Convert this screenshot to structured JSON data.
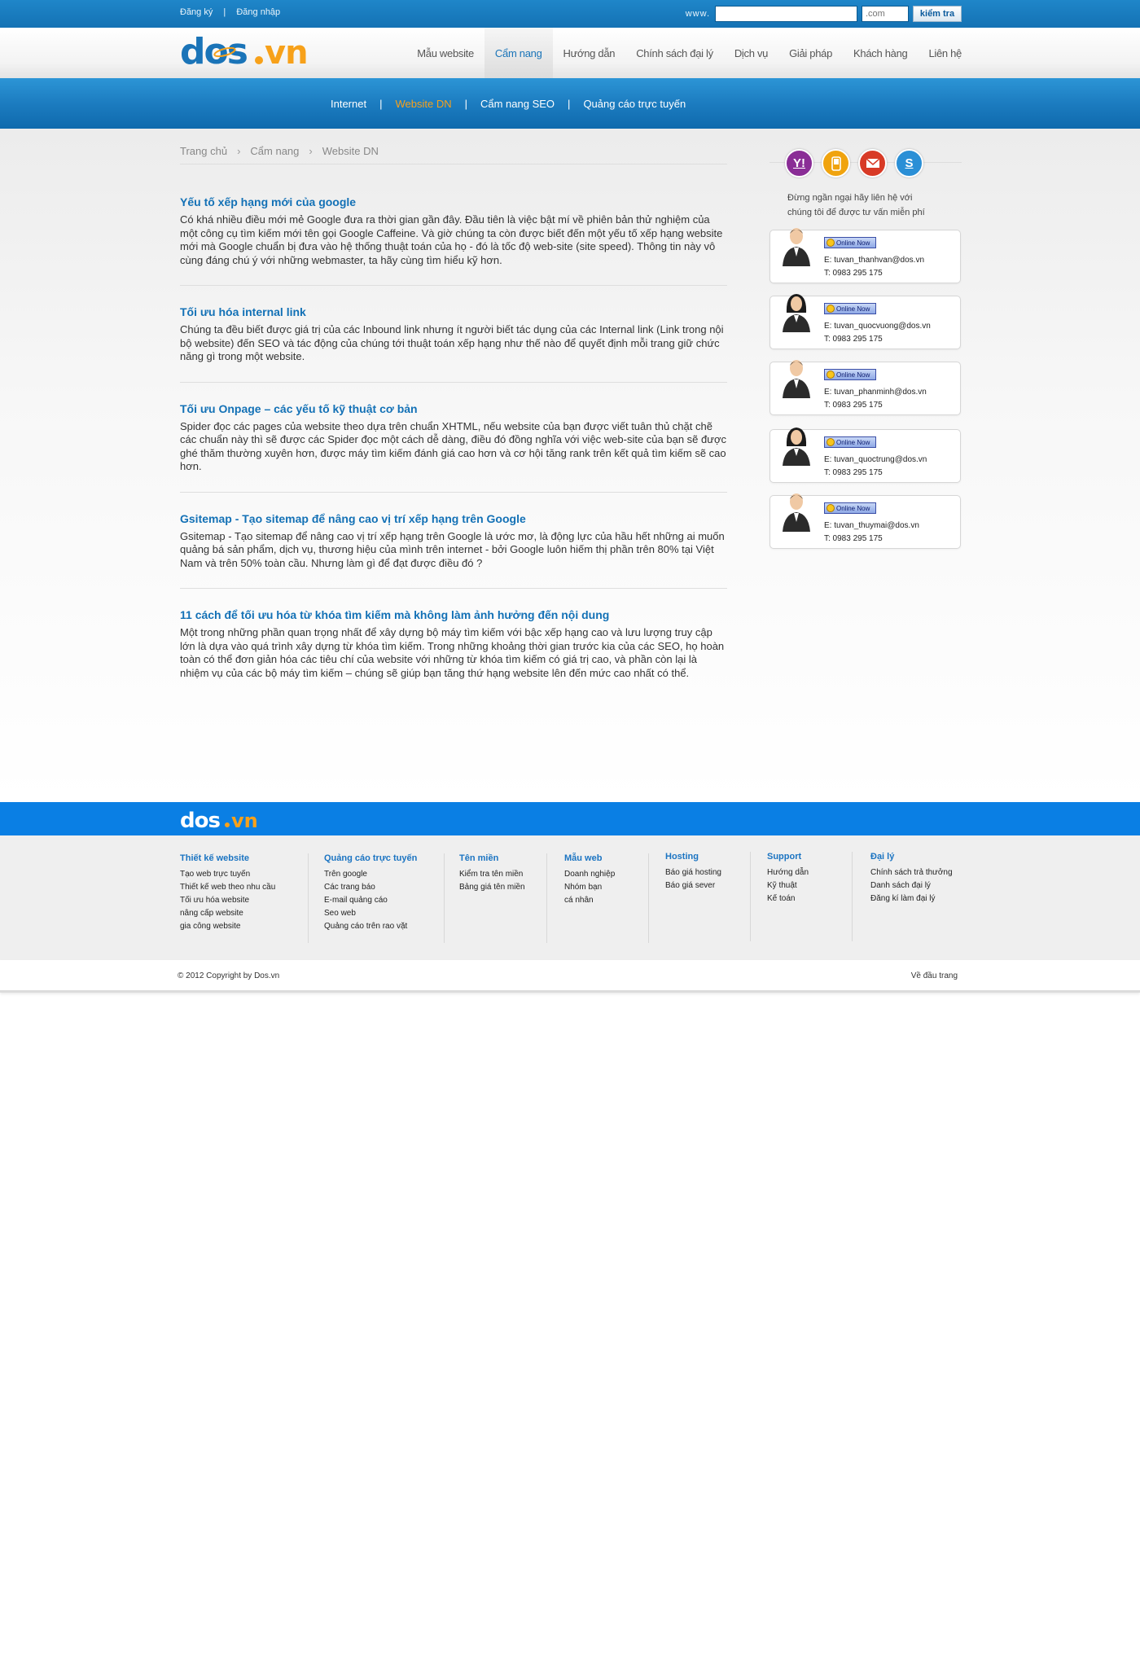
{
  "topbar": {
    "register": "Đăng ký",
    "separator": "|",
    "login": "Đăng nhập",
    "www_label": "www.",
    "domain_value": "",
    "ext_placeholder": ".com",
    "check_button": "kiểm tra"
  },
  "header": {
    "logo_text": "dos.vn",
    "nav": [
      "Mẫu website",
      "Cẩm nang",
      "Hướng dẫn",
      "Chính sách đại lý",
      "Dịch vụ",
      "Giải pháp",
      "Khách hàng",
      "Liên hệ"
    ],
    "nav_active": "Cẩm nang"
  },
  "subnav": {
    "items": [
      "Internet",
      "Website DN",
      "Cẩm nang SEO",
      "Quảng cáo trực tuyến"
    ],
    "separator": "|",
    "active": "Website DN"
  },
  "breadcrumb": [
    "Trang chủ",
    "Cẩm nang",
    "Website DN"
  ],
  "articles": [
    {
      "title": "Yếu tố xếp hạng mới của google",
      "text": "Có khá nhiều điều mới mẻ Google đưa ra thời gian gần đây. Đầu tiên là việc bật mí về phiên bản thử nghiệm của một công cụ tìm kiếm mới tên gọi Google Caffeine. Và giờ chúng ta còn được biết đến một yếu tố xếp hạng website mới mà Google chuẩn bị đưa vào hệ thống thuật toán của họ - đó là tốc độ web-site (site speed). Thông tin này vô cùng đáng chú ý với những webmaster, ta hãy cùng tìm hiểu kỹ hơn."
    },
    {
      "title": "Tối ưu hóa internal link",
      "text": "Chúng ta đều biết được giá trị của các Inbound link nhưng ít người biết tác dụng của các Internal link (Link trong nội bộ website) đến SEO và tác động của chúng tới thuật toán xếp hạng như thế nào để quyết định mỗi trang giữ chức năng gì trong một website."
    },
    {
      "title": "Tối ưu Onpage – các yếu tố kỹ thuật cơ bản",
      "text": "Spider đọc các pages của website theo dựa trên chuẩn XHTML, nếu website của bạn được viết tuân thủ chặt chẽ các chuẩn này thì sẽ được các Spider đọc một cách dễ dàng, điều đó đồng nghĩa với việc web-site của bạn sẽ được ghé thăm thường xuyên hơn, được máy tìm kiếm đánh giá cao hơn và cơ hội tăng rank trên kết quả tìm kiếm sẽ cao hơn."
    },
    {
      "title": "Gsitemap - Tạo sitemap để nâng cao vị trí xếp hạng trên Google",
      "text": "Gsitemap - Tạo sitemap để nâng cao vị trí xếp hạng trên Google là ước mơ, là động lực của hầu hết những ai muốn quảng bá sản phẩm, dịch vụ, thương hiệu của mình trên internet - bởi Google luôn hiếm thị phần trên 80% tại Việt Nam và trên 50% toàn cầu. Nhưng làm gì để đạt được điều đó ?"
    },
    {
      "title": "11 cách để tối ưu hóa từ khóa tìm kiếm mà không làm ảnh hưởng đến nội dung",
      "text": "Một trong những phần quan trọng nhất để xây dựng bộ máy tìm kiếm với bậc xếp hạng cao và lưu lượng truy cập lớn là dựa vào quá trình xây dựng từ khóa tìm kiếm. Trong những khoảng thời gian trước kia của các SEO, họ hoàn toàn có thể đơn giản hóa các tiêu chí của website với những từ khóa tìm kiếm có giá trị cao, và phần còn lại là nhiệm vụ của các bộ máy tìm kiếm – chúng sẽ giúp bạn tăng thứ hạng website lên đến mức cao nhất có thể."
    }
  ],
  "sidebar": {
    "icons": [
      "yahoo-icon",
      "phone-icon",
      "mail-icon",
      "skype-icon"
    ],
    "note_line1": "Đừng ngần ngại hãy liên hệ với",
    "note_line2": "chúng tôi để được tư vấn miễn phí",
    "agents": [
      {
        "badge": "Online Now",
        "email": "E: tuvan_thanhvan@dos.vn",
        "phone": "T: 0983 295 175",
        "gender": "male"
      },
      {
        "badge": "Online Now",
        "email": "E: tuvan_quocvuong@dos.vn",
        "phone": "T: 0983 295 175",
        "gender": "female"
      },
      {
        "badge": "Online Now",
        "email": "E: tuvan_phanminh@dos.vn",
        "phone": "T: 0983 295 175",
        "gender": "male"
      },
      {
        "badge": "Online Now",
        "email": "E: tuvan_quoctrung@dos.vn",
        "phone": "T: 0983 295 175",
        "gender": "female"
      },
      {
        "badge": "Online Now",
        "email": "E: tuvan_thuymai@dos.vn",
        "phone": "T: 0983 295 175",
        "gender": "male"
      }
    ]
  },
  "footer": {
    "logo_text": "dos.vn",
    "columns": [
      {
        "title": "Thiết kế website",
        "links": [
          "Tạo web trực tuyến",
          "Thiết kế web theo nhu cầu",
          "Tối ưu hóa website",
          "nâng cấp website",
          "gia công website"
        ]
      },
      {
        "title": "Quảng cáo trực tuyến",
        "links": [
          "Trên google",
          "Các trang báo",
          "E-mail quảng cáo",
          "Seo web",
          "Quảng cáo trên rao vặt"
        ]
      },
      {
        "title": "Tên miền",
        "links": [
          "Kiểm tra tên miền",
          "Bảng giá tên miền"
        ]
      },
      {
        "title": "Mẫu web",
        "links": [
          "Doanh nghiệp",
          "Nhóm bạn",
          "cá nhân"
        ]
      },
      {
        "title": "Hosting",
        "links": [
          "Báo giá hosting",
          "Báo giá sever"
        ]
      },
      {
        "title": "Support",
        "links": [
          "Hướng dẫn",
          "Kỹ thuật",
          "Kế toán"
        ]
      },
      {
        "title": "Đại lý",
        "links": [
          "Chính sách trả thưởng",
          "Danh sách đại lý",
          "Đăng kí làm đại lý"
        ]
      }
    ],
    "copyright": "© 2012 Copyright by Dos.vn",
    "back_to_top": "Về đầu trang"
  },
  "colors": {
    "brand_blue": "#1371b6",
    "nav_blue": "#1c7cc0",
    "accent_orange": "#f7a11a",
    "footer_blue": "#0a7fe4"
  }
}
